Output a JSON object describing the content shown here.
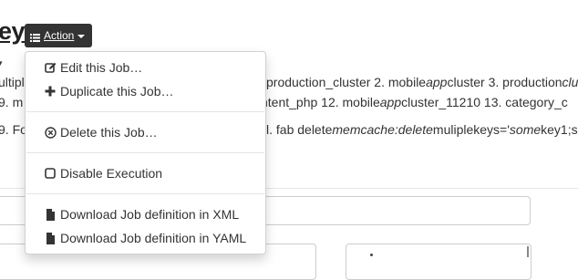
{
  "page": {
    "title": "ey",
    "background_lines": [
      {
        "pre": "ultiple",
        "main": "production_cluster 2. mobile",
        "em": "app",
        "post": "cluster 3. production",
        "em2": "clu"
      },
      {
        "pre": "9. m",
        "main": "ntent_php 12. mobile",
        "em": "app",
        "post": "cluster_11210 13. category_c",
        "em2": ""
      },
      {
        "pre": "9. Fo",
        "main": "l. fab delete",
        "em": "memcache:delete",
        "post": "muliplekeys='",
        "em2": "some",
        "tail": "key1;s"
      }
    ]
  },
  "action_button": {
    "label": "Action",
    "icon": "list-icon"
  },
  "menu": {
    "items": [
      {
        "label": "Edit this Job…",
        "icon": "edit-icon"
      },
      {
        "label": "Duplicate this Job…",
        "icon": "plus-icon"
      },
      {
        "label": "Delete this Job…",
        "icon": "circle-x-icon"
      },
      {
        "label": "Disable Execution",
        "icon": "square-icon"
      },
      {
        "label": "Download Job definition in XML",
        "icon": "file-icon"
      },
      {
        "label": "Download Job definition in YAML",
        "icon": "file-icon"
      }
    ]
  },
  "colors": {
    "button_bg": "#333333",
    "text": "#333333",
    "border": "#cccccc"
  }
}
